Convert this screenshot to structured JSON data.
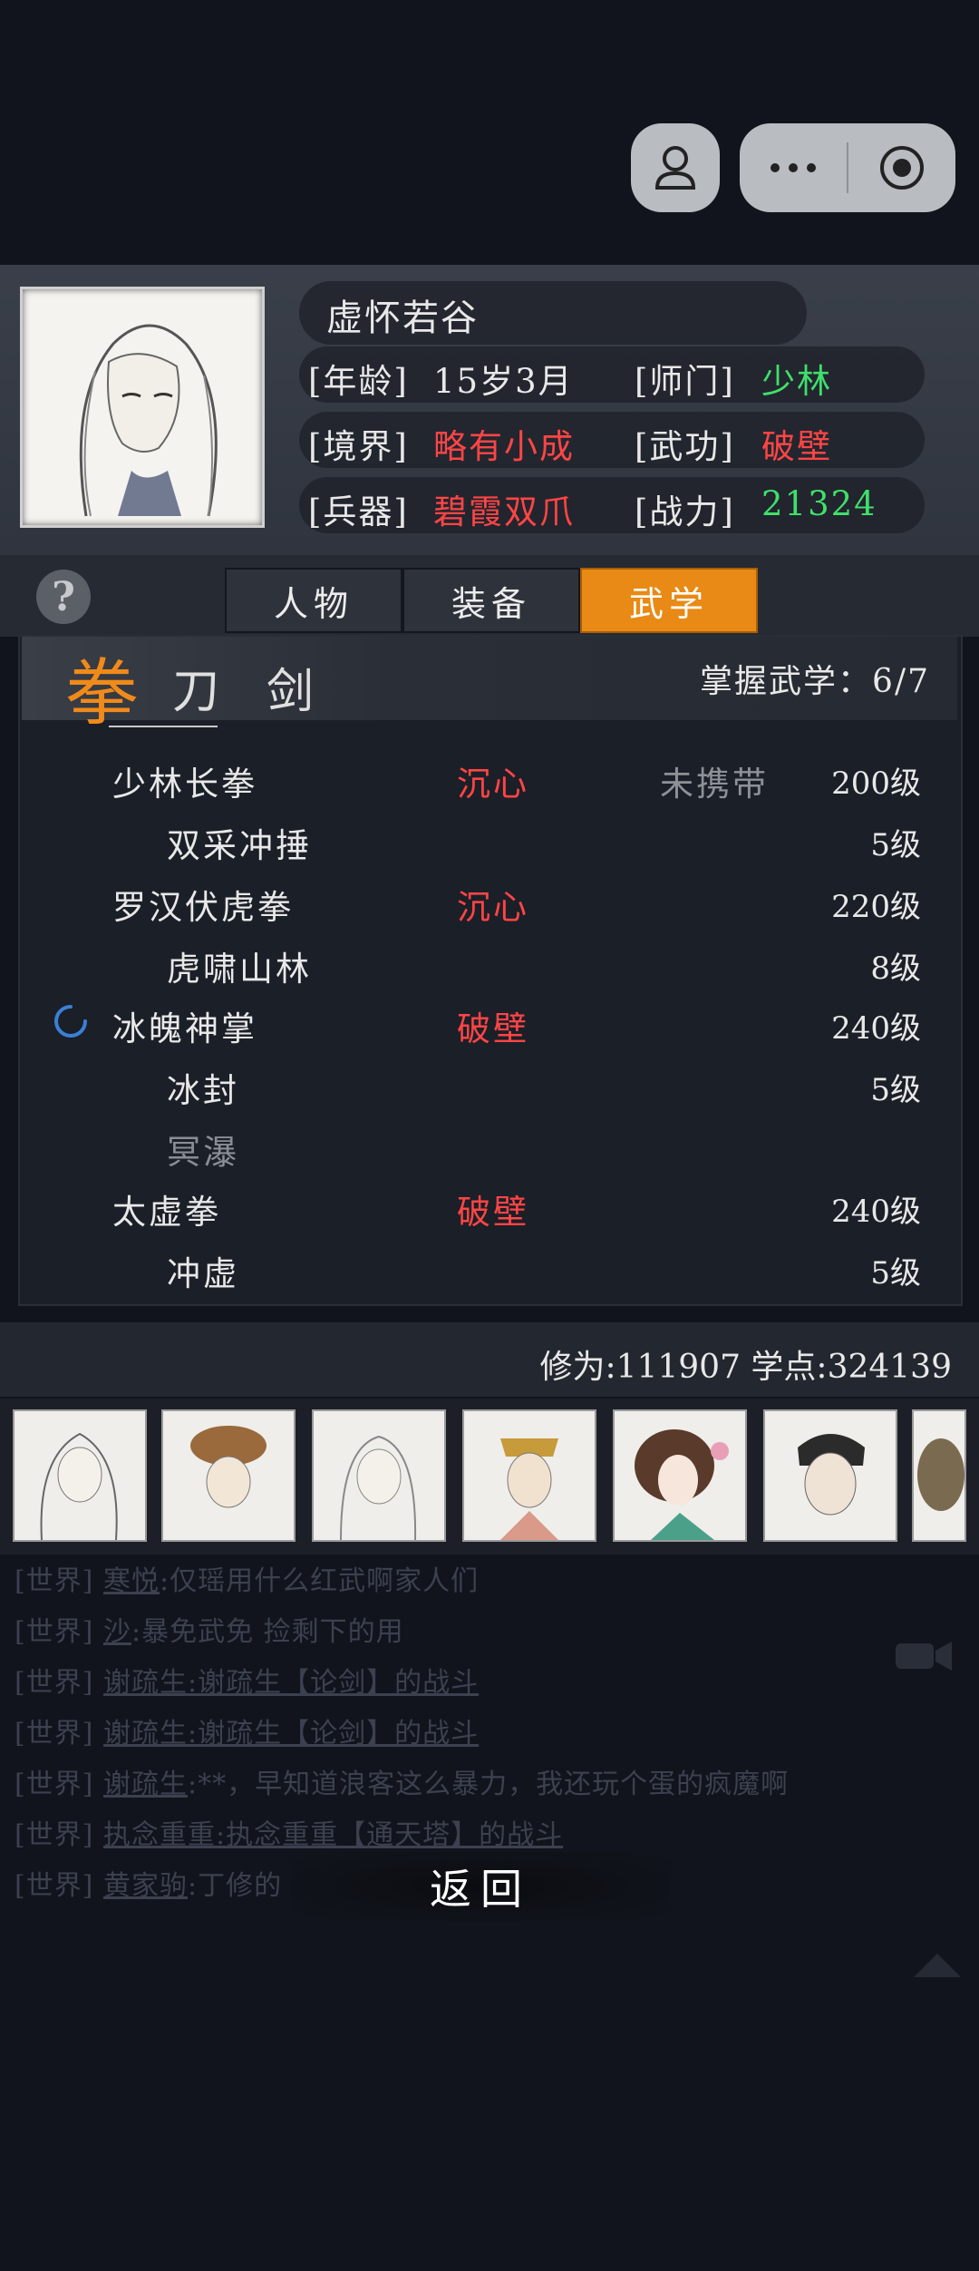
{
  "profile": {
    "name": "虚怀若谷",
    "age_label": "[年龄]",
    "age_value": "15岁3月",
    "sect_label": "[师门]",
    "sect_value": "少林",
    "realm_label": "[境界]",
    "realm_value": "略有小成",
    "skill_label": "[武功]",
    "skill_value": "破壁",
    "weapon_label": "[兵器]",
    "weapon_value": "碧霞双爪",
    "power_label": "[战力]",
    "power_value": "21324"
  },
  "tabs": [
    {
      "label": "人物",
      "active": false
    },
    {
      "label": "装备",
      "active": false
    },
    {
      "label": "武学",
      "active": true
    }
  ],
  "categories": [
    "拳",
    "刀",
    "剑"
  ],
  "mastery": "掌握武学：6/7",
  "skills": [
    {
      "name": "少林长拳",
      "status": "沉心",
      "carry": "未携带",
      "level": "200级"
    },
    {
      "name": "双采冲捶",
      "level": "5级"
    },
    {
      "name": "罗汉伏虎拳",
      "status": "沉心",
      "level": "220级"
    },
    {
      "name": "虎啸山林",
      "level": "8级"
    },
    {
      "name": "冰魄神掌",
      "status": "破壁",
      "level": "240级"
    },
    {
      "name": "冰封",
      "level": "5级"
    },
    {
      "name": "冥瀑"
    },
    {
      "name": "太虚拳",
      "status": "破壁",
      "level": "240级"
    },
    {
      "name": "冲虚",
      "level": "5级"
    }
  ],
  "stats": "修为:111907  学点:324139",
  "chat": [
    {
      "channel": "[世界]",
      "user": "寒悦",
      "text": ":仅瑶用什么红武啊家人们"
    },
    {
      "channel": "[世界]",
      "user": "沙",
      "text": ":暴免武免 捡剩下的用"
    },
    {
      "channel": "[世界]",
      "user": "谢疏生",
      "text": ":谢疏生【论剑】的战斗"
    },
    {
      "channel": "[世界]",
      "user": "谢疏生",
      "text": ":谢疏生【论剑】的战斗"
    },
    {
      "channel": "[世界]",
      "user": "谢疏生",
      "text": ":**，早知道浪客这么暴力，我还玩个蛋的疯魔啊"
    },
    {
      "channel": "[世界]",
      "user": "执念重重",
      "text": ":执念重重【通天塔】的战斗"
    },
    {
      "channel": "[世界]",
      "user": "黄家驹",
      "text": ":丁修的"
    }
  ],
  "back_label": "返回",
  "colors": {
    "accent": "#e88a15",
    "red": "#ff4545",
    "green": "#3fe06b"
  }
}
